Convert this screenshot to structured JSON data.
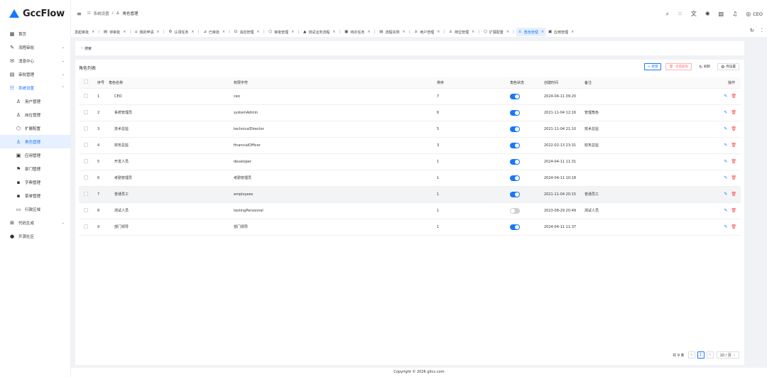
{
  "app": {
    "name": "GccFlow"
  },
  "sidebar": {
    "items": [
      {
        "icon": "▦",
        "label": "首页",
        "arrow": ""
      },
      {
        "icon": "✎",
        "label": "流程审批",
        "arrow": "⌄"
      },
      {
        "icon": "✉",
        "label": "消息中心",
        "arrow": "⌄"
      },
      {
        "icon": "▤",
        "label": "审批管理",
        "arrow": "⌄"
      },
      {
        "icon": "☷",
        "label": "系统设置",
        "arrow": "⌃"
      }
    ],
    "sub_items": [
      {
        "icon": "♙",
        "label": "用户管理"
      },
      {
        "icon": "♙",
        "label": "岗位管理"
      },
      {
        "icon": "⬡",
        "label": "扩展配置"
      },
      {
        "icon": "♙",
        "label": "角色管理"
      },
      {
        "icon": "▣",
        "label": "应用管理"
      },
      {
        "icon": "⚑",
        "label": "部门管理"
      },
      {
        "icon": "▪",
        "label": "字典管理"
      },
      {
        "icon": "▪",
        "label": "菜单管理"
      },
      {
        "icon": "▭",
        "label": "行政区域"
      }
    ],
    "bottom_items": [
      {
        "icon": "⊞",
        "label": "代码生成",
        "arrow": "⌄"
      },
      {
        "icon": "●",
        "label": "开源社区",
        "arrow": ""
      }
    ]
  },
  "header": {
    "collapse_icon": "≡",
    "breadcrumb_section": "系统设置",
    "breadcrumb_sep": "/",
    "breadcrumb_current": "角色管理",
    "user": "CEO"
  },
  "tabs": [
    {
      "label": "发起审批",
      "icon": ""
    },
    {
      "label": "待审批",
      "icon": "▤"
    },
    {
      "label": "我的申请",
      "icon": "⌂"
    },
    {
      "label": "认领任务",
      "icon": "⚙"
    },
    {
      "label": "已审批",
      "icon": "⊿"
    },
    {
      "label": "消息管理",
      "icon": "⊡"
    },
    {
      "label": "审批管理",
      "icon": "⬡"
    },
    {
      "label": "测试业务流程",
      "icon": "▲"
    },
    {
      "label": "待办任务",
      "icon": "▣"
    },
    {
      "label": "流程实例",
      "icon": "▤"
    },
    {
      "label": "用户管理",
      "icon": "♙"
    },
    {
      "label": "岗位管理",
      "icon": "♙"
    },
    {
      "label": "扩展配置",
      "icon": "⬡"
    },
    {
      "label": "角色管理",
      "icon": "♙"
    },
    {
      "label": "应用管理",
      "icon": "▣"
    }
  ],
  "search": {
    "label": "搜索"
  },
  "table": {
    "title": "角色列表",
    "actions": {
      "add": "+ 新增",
      "batch_delete": "批量删除",
      "refresh": "刷新",
      "columns": "列设置"
    },
    "columns": [
      "序号",
      "角色名称",
      "权限字符",
      "排序",
      "角色状态",
      "创建时间",
      "备注",
      "操作"
    ],
    "rows": [
      {
        "no": "1",
        "name": "CEO",
        "key": "ceo",
        "sort": "7",
        "status": true,
        "created": "2024-04-11 09:20",
        "remark": ""
      },
      {
        "no": "2",
        "name": "系统管理员",
        "key": "systemAdmin",
        "sort": "6",
        "status": true,
        "created": "2021-11-04 12:16",
        "remark": "管理角色"
      },
      {
        "no": "3",
        "name": "技术总监",
        "key": "technicalDirector",
        "sort": "5",
        "status": true,
        "created": "2021-11-04 21:10",
        "remark": "技术总监"
      },
      {
        "no": "4",
        "name": "财务总监",
        "key": "financialOfficer",
        "sort": "3",
        "status": true,
        "created": "2022-02-13 23:31",
        "remark": "财务总监"
      },
      {
        "no": "5",
        "name": "开发人员",
        "key": "developer",
        "sort": "1",
        "status": true,
        "created": "2024-04-11 11:31",
        "remark": ""
      },
      {
        "no": "6",
        "name": "考勤管理员",
        "key": "考勤管理员",
        "sort": "1",
        "status": true,
        "created": "2024-04-11 10:18",
        "remark": ""
      },
      {
        "no": "7",
        "name": "普通员工",
        "key": "employees",
        "sort": "1",
        "status": true,
        "created": "2021-11-04 20:15",
        "remark": "普通员工"
      },
      {
        "no": "8",
        "name": "测试人员",
        "key": "testingPersonnel",
        "sort": "1",
        "status": false,
        "created": "2023-08-29 20:49",
        "remark": "测试人员"
      },
      {
        "no": "9",
        "name": "部门领导",
        "key": "部门领导",
        "sort": "1",
        "status": true,
        "created": "2024-04-11 11:37",
        "remark": ""
      }
    ]
  },
  "pagination": {
    "total": "共 9 条",
    "prev": "<",
    "page": "1",
    "next": ">",
    "size": "10 / 页"
  },
  "footer": "Copyright © 2026 gitcc.com",
  "colors": {
    "accent": "#1677ff",
    "danger": "#ff4d4f"
  }
}
